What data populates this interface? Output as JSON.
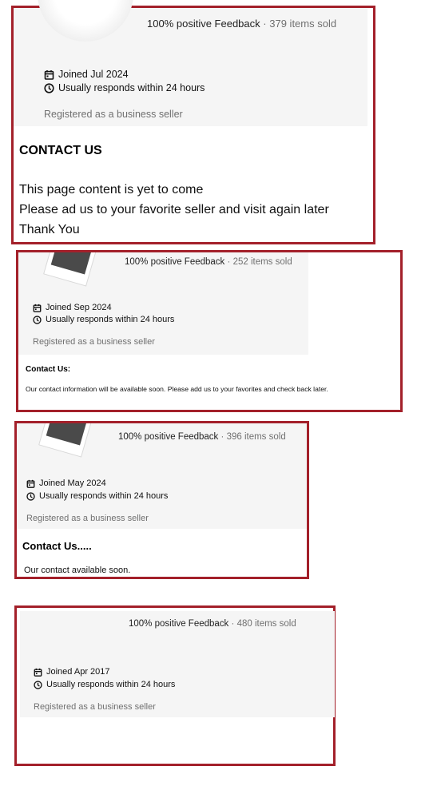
{
  "panels": [
    {
      "feedback": "100% positive Feedback",
      "separator": "·",
      "sold": "379 items sold",
      "joined": "Joined Jul 2024",
      "responds": "Usually responds within 24 hours",
      "registered": "Registered as a business seller",
      "contact_heading": "CONTACT US",
      "contact_lines": [
        "This page content is yet to come",
        "Please ad us to your favorite seller and visit again later",
        "Thank You"
      ]
    },
    {
      "feedback": "100% positive Feedback",
      "separator": "·",
      "sold": "252 items sold",
      "joined": "Joined Sep 2024",
      "responds": "Usually responds within 24 hours",
      "registered": "Registered as a business seller",
      "contact_heading": "Contact Us:",
      "contact_lines": [
        "Our contact information will be available soon. Please add us to your favorites and check back later."
      ]
    },
    {
      "feedback": "100% positive Feedback",
      "separator": "·",
      "sold": "396 items sold",
      "joined": "Joined May 2024",
      "responds": "Usually responds within 24 hours",
      "registered": "Registered as a business seller",
      "contact_heading": "Contact Us.....",
      "contact_lines": [
        "Our contact available soon."
      ]
    },
    {
      "feedback": "100% positive Feedback",
      "separator": "·",
      "sold": "480 items sold",
      "joined": "Joined Apr 2017",
      "responds": "Usually responds within 24 hours",
      "registered": "Registered as a business seller"
    }
  ],
  "colors": {
    "frame": "#a3202a",
    "panel_bg": "#f5f5f5",
    "muted_text": "#707070"
  },
  "icons": [
    "calendar-icon",
    "clock-icon"
  ]
}
